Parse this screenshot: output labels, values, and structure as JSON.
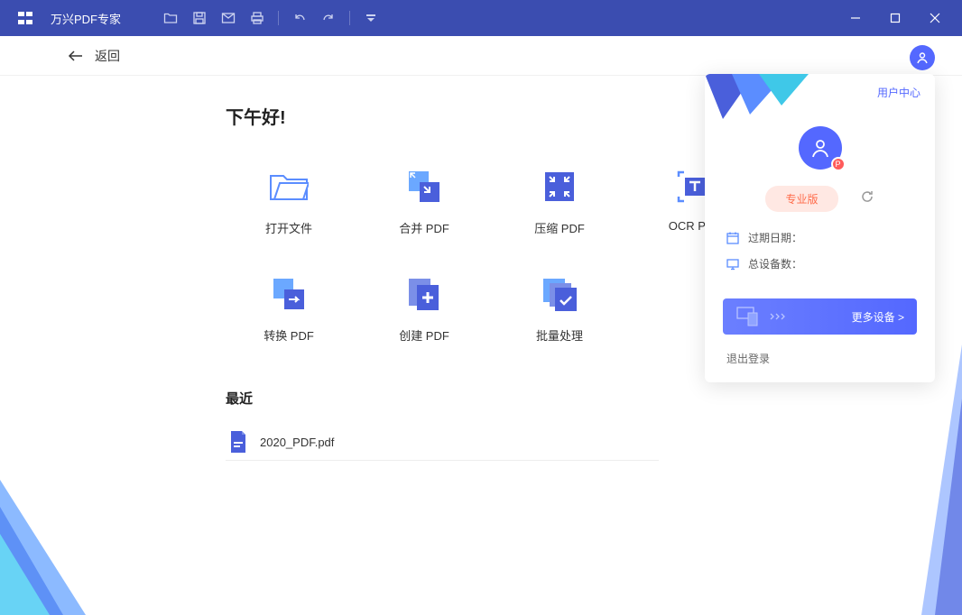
{
  "app": {
    "title": "万兴PDF专家"
  },
  "subheader": {
    "back": "返回"
  },
  "main": {
    "greeting": "下午好!",
    "recent_title": "最近",
    "actions": [
      {
        "label": "打开文件"
      },
      {
        "label": "合并 PDF"
      },
      {
        "label": "压缩 PDF"
      },
      {
        "label": "OCR PDF"
      },
      {
        "label": "转换 PDF"
      },
      {
        "label": "创建 PDF"
      },
      {
        "label": "批量处理"
      }
    ],
    "recent": [
      {
        "name": "2020_PDF.pdf"
      }
    ]
  },
  "userPanel": {
    "centerLink": "用户中心",
    "avatarBadge": "P",
    "proBadge": "专业版",
    "info": {
      "expiry": "过期日期：",
      "devices": "总设备数："
    },
    "moreDevices": "更多设备 >",
    "logout": "退出登录"
  }
}
